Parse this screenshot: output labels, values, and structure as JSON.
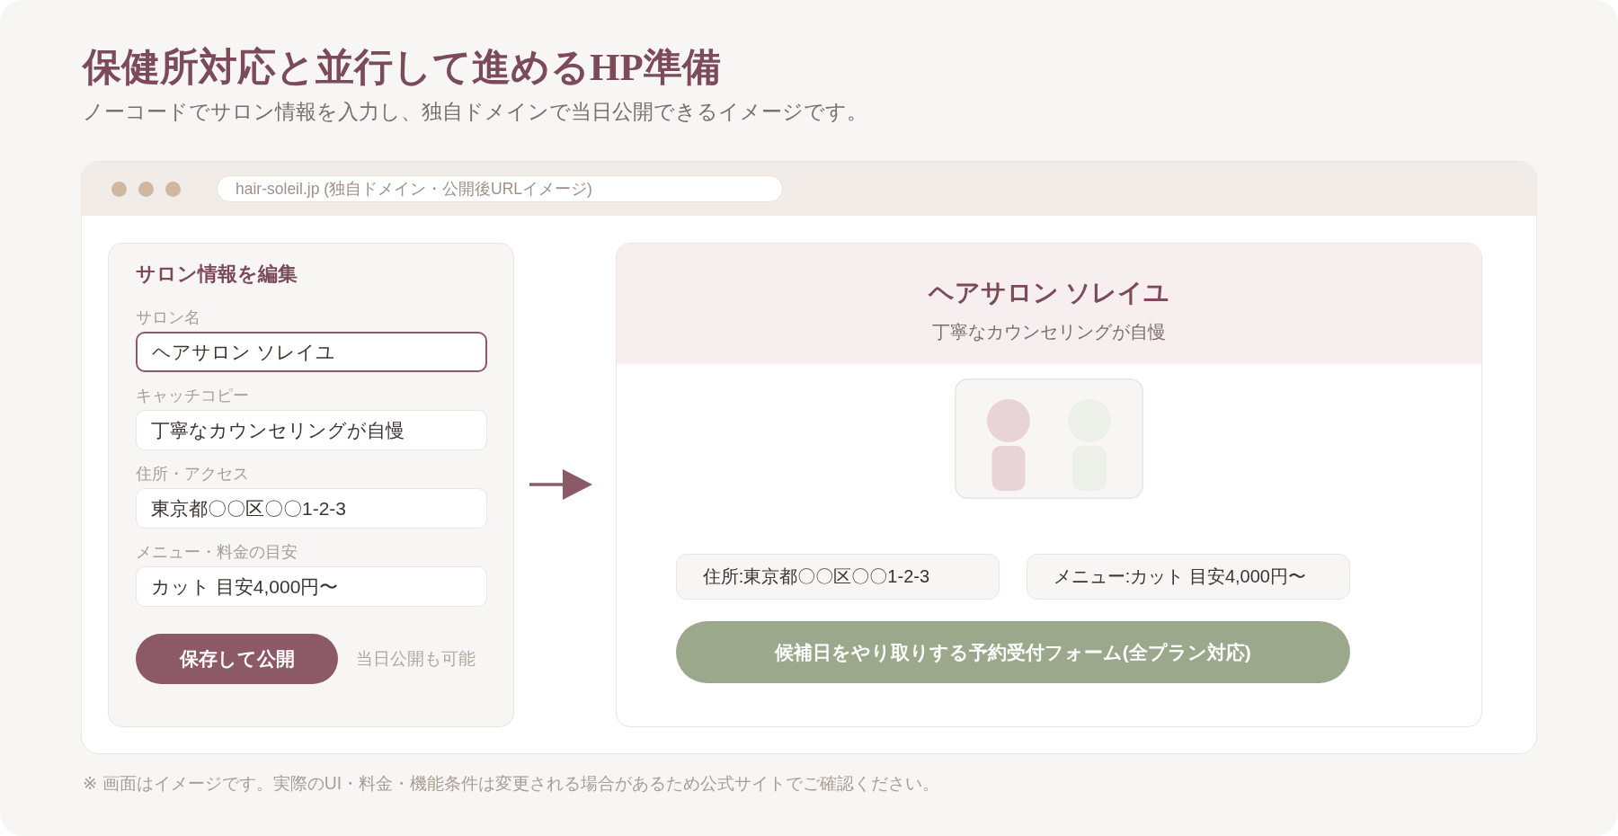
{
  "title": "保健所対応と並行して進めるHP準備",
  "subtitle": "ノーコードでサロン情報を入力し、独自ドメインで当日公開できるイメージです。",
  "browser": {
    "url": "hair-soleil.jp (独自ドメイン・公開後URLイメージ)"
  },
  "editor": {
    "heading": "サロン情報を編集",
    "fields": [
      {
        "label": "サロン名",
        "value": "ヘアサロン ソレイユ",
        "focused": true
      },
      {
        "label": "キャッチコピー",
        "value": "丁寧なカウンセリングが自慢",
        "focused": false
      },
      {
        "label": "住所・アクセス",
        "value": "東京都〇〇区〇〇1-2-3",
        "focused": false
      },
      {
        "label": "メニュー・料金の目安",
        "value": "カット 目安4,000円〜",
        "focused": false
      }
    ],
    "save_button": "保存して公開",
    "note": "当日公開も可能"
  },
  "preview": {
    "salon_name": "ヘアサロン ソレイユ",
    "tagline": "丁寧なカウンセリングが自慢",
    "info_chips": [
      "住所:東京都〇〇区〇〇1-2-3",
      "メニュー:カット 目安4,000円〜"
    ],
    "reservation_button": "候補日をやり取りする予約受付フォーム(全プラン対応)"
  },
  "footnote": "※ 画面はイメージです。実際のUI・料金・機能条件は変更される場合があるため公式サイトでご確認ください。"
}
